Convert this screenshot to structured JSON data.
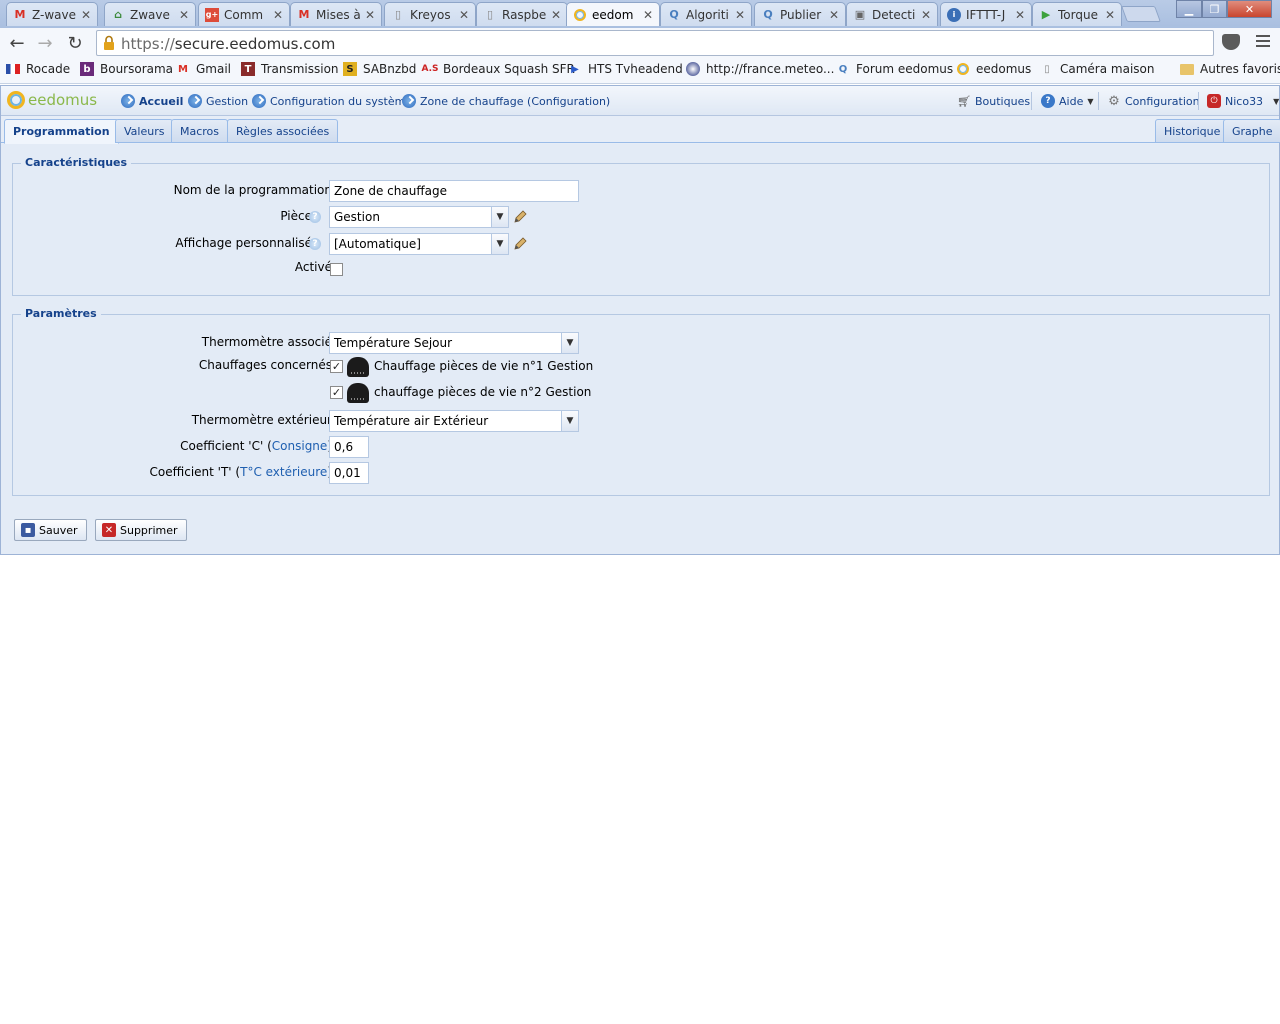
{
  "browser": {
    "tabs": [
      {
        "title": "Z-wave",
        "icon": "gmail-icon"
      },
      {
        "title": "Zwave",
        "icon": "house-icon"
      },
      {
        "title": "Comm",
        "icon": "google-plus-icon"
      },
      {
        "title": "Mises à",
        "icon": "gmail-icon"
      },
      {
        "title": "Kreyos",
        "icon": "page-icon"
      },
      {
        "title": "Raspbe",
        "icon": "page-icon"
      },
      {
        "title": "eedom",
        "icon": "eedomus-icon"
      },
      {
        "title": "Algoriti",
        "icon": "eedomus-forum-icon"
      },
      {
        "title": "Publier",
        "icon": "eedomus-forum-icon"
      },
      {
        "title": "Detecti",
        "icon": "photo-icon"
      },
      {
        "title": "IFTTT-J",
        "icon": "drop-icon"
      },
      {
        "title": "Torque",
        "icon": "play-icon"
      }
    ],
    "url_protocol": "https://",
    "url_host": "secure.eedomus.com",
    "bookmarks": [
      {
        "label": "Rocade",
        "icon": "flag-fr-icon"
      },
      {
        "label": "Boursorama",
        "icon": "boursorama-icon"
      },
      {
        "label": "Gmail",
        "icon": "gmail-icon"
      },
      {
        "label": "Transmission",
        "icon": "transmission-icon"
      },
      {
        "label": "SABnzbd",
        "icon": "sabnzbd-icon"
      },
      {
        "label": "Bordeaux Squash SFR",
        "icon": "as-icon"
      },
      {
        "label": "HTS Tvheadend",
        "icon": "hts-icon"
      },
      {
        "label": "http://france.meteo...",
        "icon": "meteo-icon"
      },
      {
        "label": "Forum eedomus",
        "icon": "eedomus-forum-icon"
      },
      {
        "label": "eedomus",
        "icon": "eedomus-icon"
      },
      {
        "label": "Caméra maison",
        "icon": "page-icon"
      },
      {
        "label": "Autres favoris",
        "icon": "folder-icon"
      }
    ]
  },
  "app": {
    "logo_text": "eedomus",
    "breadcrumb": [
      "Accueil",
      "Gestion",
      "Configuration du système",
      "Zone de chauffage (Configuration)"
    ],
    "right_nav": {
      "shops": "Boutiques",
      "help": "Aide",
      "config": "Configuration",
      "user": "Nico33"
    },
    "tabs_left": [
      "Programmation",
      "Valeurs",
      "Macros",
      "Règles associées"
    ],
    "tabs_right": [
      "Historique",
      "Graphe"
    ],
    "active_tab": "Programmation"
  },
  "form": {
    "section1": {
      "legend": "Caractéristiques",
      "name_label": "Nom de la programmation",
      "name_value": "Zone de chauffage",
      "room_label": "Pièce",
      "room_value": "Gestion",
      "display_label": "Affichage personnalisé",
      "display_value": "[Automatique]",
      "active_label": "Activé",
      "active_checked": false
    },
    "section2": {
      "legend": "Paramètres",
      "thermo_label": "Thermomètre associé",
      "thermo_value": "Température Sejour",
      "heaters_label": "Chauffages concernés",
      "heater1": "Chauffage pièces de vie n°1 Gestion",
      "heater2": "chauffage pièces de vie n°2 Gestion",
      "ext_label": "Thermomètre extérieur",
      "ext_value": "Température air Extérieur",
      "coefc_label": "Coefficient 'C' (",
      "coefc_link": "Consigne",
      "coefc_close": ")",
      "coefc_value": "0,6",
      "coeft_label": "Coefficient 'T' (",
      "coeft_link": "T°C extérieure",
      "coeft_close": ")",
      "coeft_value": "0,01"
    },
    "save_label": "Sauver",
    "delete_label": "Supprimer"
  },
  "colors": {
    "accent": "#15428b",
    "panel": "#e3ebf6",
    "logo_green": "#8ab84a"
  }
}
